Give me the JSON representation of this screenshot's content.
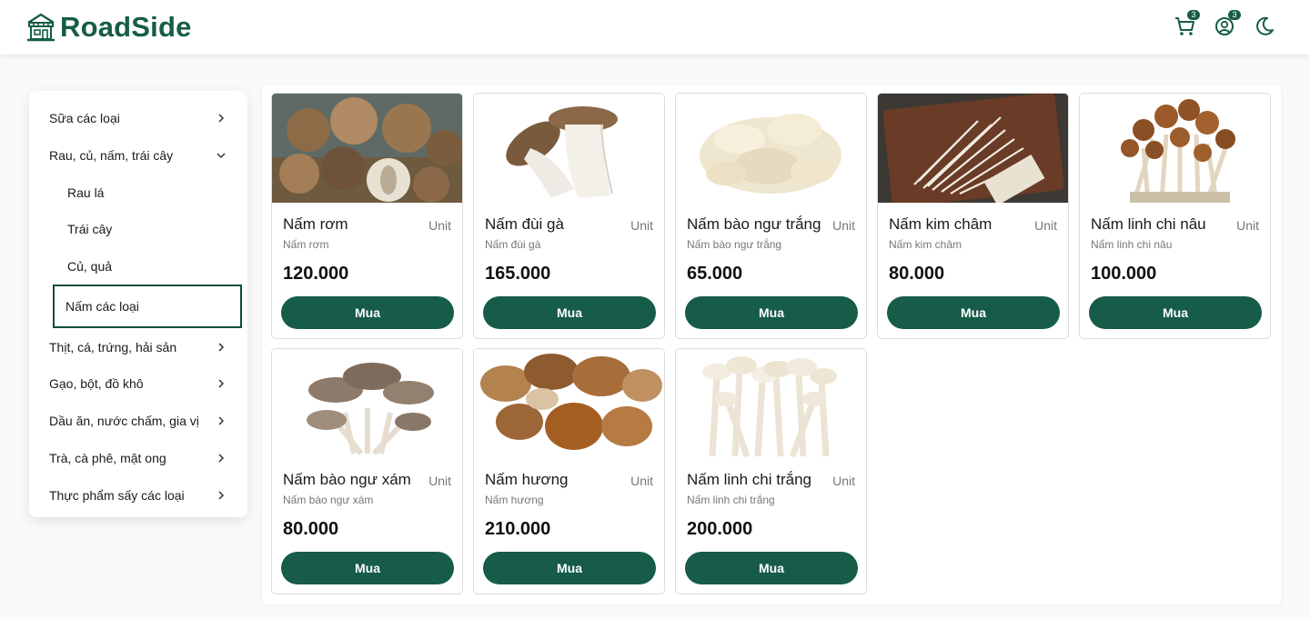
{
  "header": {
    "brand": "RoadSide",
    "cart_count": "3",
    "account_count": "3",
    "icons": [
      "cart-icon",
      "user-circle-icon",
      "moon-icon"
    ]
  },
  "sidebar": {
    "categories": [
      {
        "label": "Sữa các loại",
        "expanded": false
      },
      {
        "label": "Rau, củ, nấm, trái cây",
        "expanded": true
      },
      {
        "label": "Thịt, cá, trứng, hải sản",
        "expanded": false
      },
      {
        "label": "Gạo, bột, đồ khô",
        "expanded": false
      },
      {
        "label": "Dầu ăn, nước chấm, gia vị",
        "expanded": false
      },
      {
        "label": "Trà, cà phê, mật ong",
        "expanded": false
      },
      {
        "label": "Thực phẩm sấy các loại",
        "expanded": false
      }
    ],
    "subcategories": [
      {
        "label": "Rau lá"
      },
      {
        "label": "Trái cây"
      },
      {
        "label": "Củ, quả"
      },
      {
        "label": "Nấm các loại",
        "active": true
      }
    ]
  },
  "products": [
    {
      "name": "Nấm rơm",
      "subtitle": "Nấm rơm",
      "unit": "Unit",
      "price": "120.000",
      "button": "Mua"
    },
    {
      "name": "Nấm đùi gà",
      "subtitle": "Nấm đùi gà",
      "unit": "Unit",
      "price": "165.000",
      "button": "Mua"
    },
    {
      "name": "Nấm bào ngư trắng",
      "subtitle": "Nấm bào ngư trắng",
      "unit": "Unit",
      "price": "65.000",
      "button": "Mua"
    },
    {
      "name": "Nấm kim châm",
      "subtitle": "Nấm kim châm",
      "unit": "Unit",
      "price": "80.000",
      "button": "Mua"
    },
    {
      "name": "Nấm linh chi nâu",
      "subtitle": "Nấm linh chi nâu",
      "unit": "Unit",
      "price": "100.000",
      "button": "Mua"
    },
    {
      "name": "Nấm bào ngư xám",
      "subtitle": "Nấm bào ngư xám",
      "unit": "Unit",
      "price": "80.000",
      "button": "Mua"
    },
    {
      "name": "Nấm hương",
      "subtitle": "Nấm hương",
      "unit": "Unit",
      "price": "210.000",
      "button": "Mua"
    },
    {
      "name": "Nấm linh chi trắng",
      "subtitle": "Nấm linh chi trắng",
      "unit": "Unit",
      "price": "200.000",
      "button": "Mua"
    }
  ],
  "colors": {
    "brand": "#165c48",
    "button": "#165c48",
    "muted_text": "#777777"
  }
}
